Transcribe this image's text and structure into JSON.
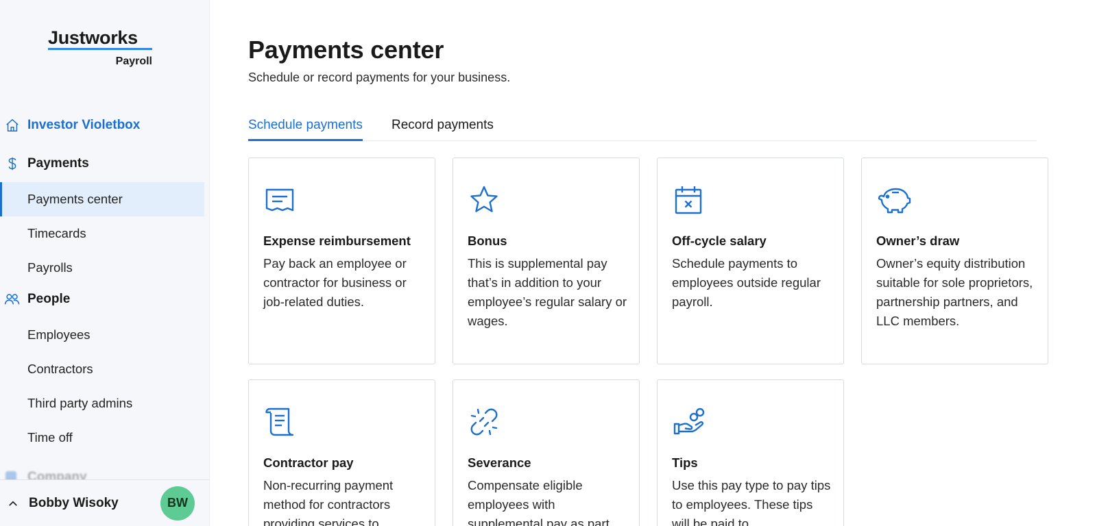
{
  "brand": {
    "name": "Justworks",
    "product": "Payroll"
  },
  "sidebar": {
    "account": {
      "label": "Investor Violetbox",
      "icon": "home-icon"
    },
    "sections": [
      {
        "label": "Payments",
        "icon": "dollar-icon",
        "items": [
          {
            "label": "Payments center",
            "active": true
          },
          {
            "label": "Timecards"
          },
          {
            "label": "Payrolls"
          }
        ]
      },
      {
        "label": "People",
        "icon": "people-icon",
        "items": [
          {
            "label": "Employees"
          },
          {
            "label": "Contractors"
          },
          {
            "label": "Third party admins"
          },
          {
            "label": "Time off"
          }
        ]
      }
    ],
    "faded_section": {
      "label": "Company"
    },
    "user": {
      "name": "Bobby Wisoky",
      "initials": "BW"
    }
  },
  "main": {
    "title": "Payments center",
    "subtitle": "Schedule or record payments for your business.",
    "tabs": [
      {
        "label": "Schedule payments",
        "active": true
      },
      {
        "label": "Record payments"
      }
    ],
    "cards": [
      {
        "icon": "receipt-icon",
        "title": "Expense reimbursement",
        "description": "Pay back an employee or contractor for business or job-related duties."
      },
      {
        "icon": "star-icon",
        "title": "Bonus",
        "description": "This is supplemental pay that’s in addition to your employee’s regular salary or wages."
      },
      {
        "icon": "calendar-x-icon",
        "title": "Off-cycle salary",
        "description": "Schedule payments to employees outside regular payroll."
      },
      {
        "icon": "piggy-bank-icon",
        "title": "Owner’s draw",
        "description": "Owner’s equity distribution suitable for sole proprietors, partnership partners, and LLC members."
      },
      {
        "icon": "scroll-icon",
        "title": "Contractor pay",
        "description": "Non-recurring payment method for contractors providing services to"
      },
      {
        "icon": "broken-link-icon",
        "title": "Severance",
        "description": "Compensate eligible employees with supplemental pay as part"
      },
      {
        "icon": "hand-coins-icon",
        "title": "Tips",
        "description": "Use this pay type to pay tips to employees. These tips will be paid to"
      }
    ]
  },
  "colors": {
    "accent": "#1b6fd0",
    "active_bg": "#e2eefb",
    "avatar": "#5ecb94",
    "logo_underline": "#2f86e6"
  }
}
